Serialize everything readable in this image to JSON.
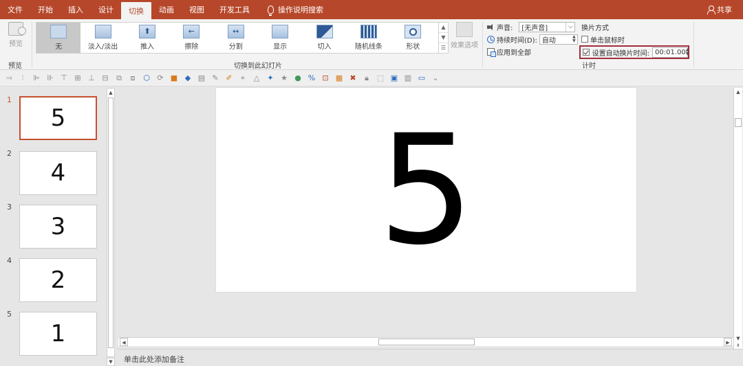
{
  "tabs": [
    {
      "label": "文件"
    },
    {
      "label": "开始"
    },
    {
      "label": "插入"
    },
    {
      "label": "设计"
    },
    {
      "label": "切换"
    },
    {
      "label": "动画"
    },
    {
      "label": "视图"
    },
    {
      "label": "开发工具"
    }
  ],
  "active_tab": "切换",
  "tell_me": "操作说明搜索",
  "share": "共享",
  "accent_color": "#b7472a",
  "preview": {
    "button": "预览",
    "group": "预览"
  },
  "transitions": {
    "group": "切换到此幻灯片",
    "items": [
      {
        "label": "无",
        "icon": "none-transition-icon"
      },
      {
        "label": "淡入/淡出",
        "icon": "fade-transition-icon"
      },
      {
        "label": "推入",
        "icon": "push-transition-icon"
      },
      {
        "label": "擦除",
        "icon": "wipe-transition-icon"
      },
      {
        "label": "分割",
        "icon": "split-transition-icon"
      },
      {
        "label": "显示",
        "icon": "reveal-transition-icon"
      },
      {
        "label": "切入",
        "icon": "cut-transition-icon"
      },
      {
        "label": "随机线条",
        "icon": "random-bars-transition-icon"
      },
      {
        "label": "形状",
        "icon": "shape-transition-icon"
      }
    ],
    "selected": "无",
    "effect_options": "效果选项"
  },
  "timing": {
    "group": "计时",
    "sound_label": "声音:",
    "sound_value": "[无声音]",
    "duration_label": "持续时间(D):",
    "duration_value": "自动",
    "apply_all": "应用到全部",
    "advance_title": "换片方式",
    "on_click": "单击鼠标时",
    "on_click_checked": false,
    "after_label": "设置自动换片时间:",
    "after_checked": true,
    "after_value": "00:01.00"
  },
  "slides": [
    {
      "number": "1",
      "content": "5",
      "selected": true
    },
    {
      "number": "2",
      "content": "4",
      "selected": false
    },
    {
      "number": "3",
      "content": "3",
      "selected": false
    },
    {
      "number": "4",
      "content": "2",
      "selected": false
    },
    {
      "number": "5",
      "content": "1",
      "selected": false
    }
  ],
  "current_slide_content": "5",
  "notes_placeholder": "单击此处添加备注"
}
